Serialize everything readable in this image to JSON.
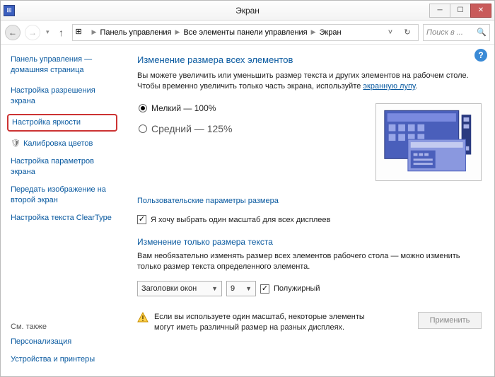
{
  "window": {
    "title": "Экран",
    "min_tooltip": "Свернуть",
    "max_tooltip": "Развернуть",
    "close_tooltip": "Закрыть"
  },
  "breadcrumb": {
    "items": [
      "Панель управления",
      "Все элементы панели управления",
      "Экран"
    ],
    "search_placeholder": "Поиск в ..."
  },
  "sidebar": {
    "home": "Панель управления — домашняя страница",
    "links": [
      "Настройка разрешения экрана",
      "Настройка яркости",
      "Калибровка цветов",
      "Настройка параметров экрана",
      "Передать изображение на второй экран",
      "Настройка текста ClearType"
    ],
    "footer_header": "См. также",
    "footer_links": [
      "Персонализация",
      "Устройства и принтеры"
    ]
  },
  "main": {
    "heading1": "Изменение размера всех элементов",
    "desc1a": "Вы можете увеличить или уменьшить размер текста и других элементов на рабочем столе. Чтобы временно увеличить только часть экрана, используйте ",
    "desc1_link": "экранную лупу",
    "desc1b": ".",
    "radio_small": "Мелкий — 100%",
    "radio_medium": "Средний — 125%",
    "custom_link": "Пользовательские параметры размера",
    "chk_same_scale": "Я хочу выбрать один масштаб для всех дисплеев",
    "heading2": "Изменение только размера текста",
    "desc2": "Вам необязательно изменять размер всех элементов рабочего стола — можно изменить только размер текста определенного элемента.",
    "combo_element": "Заголовки окон",
    "combo_size": "9",
    "chk_bold": "Полужирный",
    "warning": "Если вы используете один масштаб, некоторые элементы могут иметь различный размер на разных дисплеях.",
    "apply": "Применить"
  }
}
